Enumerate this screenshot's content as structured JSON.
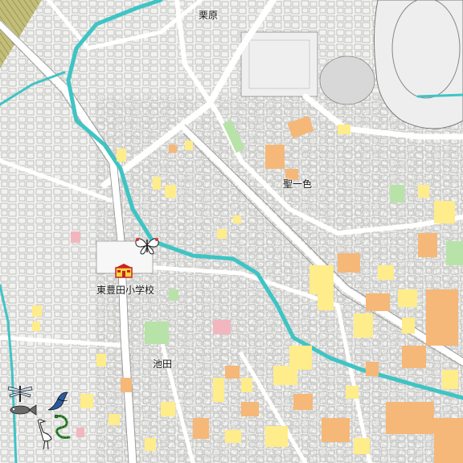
{
  "map": {
    "place_labels": {
      "kurihara": "栗原",
      "seiisshiki": "聖一色",
      "ikeda": "池田",
      "school": "東豊田小学校"
    },
    "markers": {
      "butterfly": "butterfly-icon",
      "school": "school-icon",
      "heron": "heron-icon",
      "fish": "fish-icon",
      "dragonfly": "dragonfly-icon",
      "snake": "snake-icon"
    },
    "colors": {
      "background": "#f4f4f2",
      "road": "#ffffff",
      "building_outline": "#8a8a8a",
      "river": "#3fc4c4",
      "field": "#b5b169",
      "house_yellow": "#ffec8a",
      "house_orange": "#f5b878",
      "greenery": "#b8e3a8",
      "pink": "#f2b6bf"
    }
  }
}
